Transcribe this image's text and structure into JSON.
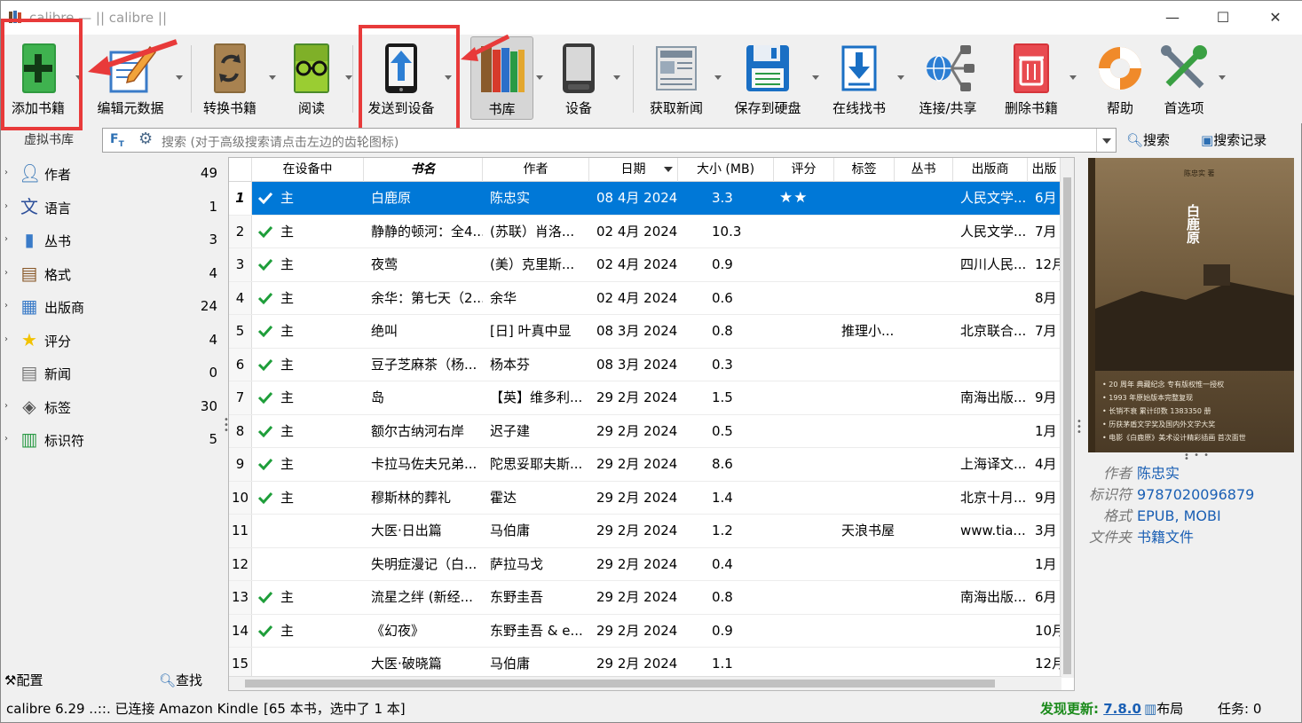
{
  "window": {
    "title": "calibre — || calibre ||",
    "minimize": "—",
    "maximize": "☐",
    "close": "✕"
  },
  "toolbar": {
    "add_books": "添加书籍",
    "edit_metadata": "编辑元数据",
    "convert_books": "转换书籍",
    "view": "阅读",
    "send_to_device": "发送到设备",
    "library": "书库",
    "device": "设备",
    "fetch_news": "获取新闻",
    "save_to_disk": "保存到硬盘",
    "get_books": "在线找书",
    "connect_share": "连接/共享",
    "remove_books": "删除书籍",
    "help": "帮助",
    "preferences": "首选项"
  },
  "search": {
    "virtual_library": "虚拟书库",
    "placeholder": "搜索 (对于高级搜索请点击左边的齿轮图标)",
    "search_button": "搜索",
    "saved_searches_button": "搜索记录"
  },
  "tag_browser": {
    "items": [
      {
        "name": "作者",
        "count": "49",
        "icon": "person-icon",
        "expandable": true
      },
      {
        "name": "语言",
        "count": "1",
        "icon": "language-icon",
        "expandable": true
      },
      {
        "name": "丛书",
        "count": "3",
        "icon": "series-icon",
        "expandable": true
      },
      {
        "name": "格式",
        "count": "4",
        "icon": "format-icon",
        "expandable": true
      },
      {
        "name": "出版商",
        "count": "24",
        "icon": "publisher-icon",
        "expandable": true
      },
      {
        "name": "评分",
        "count": "4",
        "icon": "star-icon",
        "expandable": true
      },
      {
        "name": "新闻",
        "count": "0",
        "icon": "news-icon",
        "expandable": false
      },
      {
        "name": "标签",
        "count": "30",
        "icon": "tag-icon",
        "expandable": true
      },
      {
        "name": "标识符",
        "count": "5",
        "icon": "barcode-icon",
        "expandable": true
      }
    ],
    "configure": "配置",
    "find": "查找"
  },
  "book_list": {
    "columns": [
      "在设备中",
      "书名",
      "作者",
      "日期",
      "大小 (MB)",
      "评分",
      "标签",
      "丛书",
      "出版商",
      "出版"
    ],
    "rows": [
      {
        "n": "1",
        "on_device": "主",
        "checked": true,
        "title": "白鹿原",
        "author": "陈忠实",
        "date": "08 4月 2024",
        "size": "3.3",
        "rating": "★★",
        "tags": "",
        "series": "",
        "publisher": "人民文学...",
        "pub": "6月"
      },
      {
        "n": "2",
        "on_device": "主",
        "checked": true,
        "title": "静静的顿河：全4...",
        "author": "(苏联）肖洛...",
        "date": "02 4月 2024",
        "size": "10.3",
        "rating": "",
        "tags": "",
        "series": "",
        "publisher": "人民文学...",
        "pub": "7月"
      },
      {
        "n": "3",
        "on_device": "主",
        "checked": true,
        "title": "夜莺",
        "author": "(美）克里斯...",
        "date": "02 4月 2024",
        "size": "0.9",
        "rating": "",
        "tags": "",
        "series": "",
        "publisher": "四川人民...",
        "pub": "12月"
      },
      {
        "n": "4",
        "on_device": "主",
        "checked": true,
        "title": "余华：第七天（2...",
        "author": "余华",
        "date": "02 4月 2024",
        "size": "0.6",
        "rating": "",
        "tags": "",
        "series": "",
        "publisher": "",
        "pub": "8月"
      },
      {
        "n": "5",
        "on_device": "主",
        "checked": true,
        "title": "绝叫",
        "author": "[日] 叶真中显",
        "date": "08 3月 2024",
        "size": "0.8",
        "rating": "",
        "tags": "推理小...",
        "series": "",
        "publisher": "北京联合...",
        "pub": "7月"
      },
      {
        "n": "6",
        "on_device": "主",
        "checked": true,
        "title": "豆子芝麻茶（杨...",
        "author": "杨本芬",
        "date": "08 3月 2024",
        "size": "0.3",
        "rating": "",
        "tags": "",
        "series": "",
        "publisher": "",
        "pub": ""
      },
      {
        "n": "7",
        "on_device": "主",
        "checked": true,
        "title": "岛",
        "author": "【英】维多利...",
        "date": "29 2月 2024",
        "size": "1.5",
        "rating": "",
        "tags": "",
        "series": "",
        "publisher": "南海出版...",
        "pub": "9月"
      },
      {
        "n": "8",
        "on_device": "主",
        "checked": true,
        "title": "额尔古纳河右岸",
        "author": "迟子建",
        "date": "29 2月 2024",
        "size": "0.5",
        "rating": "",
        "tags": "",
        "series": "",
        "publisher": "",
        "pub": "1月"
      },
      {
        "n": "9",
        "on_device": "主",
        "checked": true,
        "title": "卡拉马佐夫兄弟...",
        "author": "陀思妥耶夫斯...",
        "date": "29 2月 2024",
        "size": "8.6",
        "rating": "",
        "tags": "",
        "series": "",
        "publisher": "上海译文...",
        "pub": "4月"
      },
      {
        "n": "10",
        "on_device": "主",
        "checked": true,
        "title": "穆斯林的葬礼",
        "author": "霍达",
        "date": "29 2月 2024",
        "size": "1.4",
        "rating": "",
        "tags": "",
        "series": "",
        "publisher": "北京十月...",
        "pub": "9月"
      },
      {
        "n": "11",
        "on_device": "",
        "checked": false,
        "title": "大医·日出篇",
        "author": "马伯庸",
        "date": "29 2月 2024",
        "size": "1.2",
        "rating": "",
        "tags": "天浪书屋",
        "series": "",
        "publisher": "www.tia...",
        "pub": "3月"
      },
      {
        "n": "12",
        "on_device": "",
        "checked": false,
        "title": "失明症漫记（白...",
        "author": "萨拉马戈",
        "date": "29 2月 2024",
        "size": "0.4",
        "rating": "",
        "tags": "",
        "series": "",
        "publisher": "",
        "pub": "1月"
      },
      {
        "n": "13",
        "on_device": "主",
        "checked": true,
        "title": "流星之绊 (新经...",
        "author": "东野圭吾",
        "date": "29 2月 2024",
        "size": "0.8",
        "rating": "",
        "tags": "",
        "series": "",
        "publisher": "南海出版...",
        "pub": "6月"
      },
      {
        "n": "14",
        "on_device": "主",
        "checked": true,
        "title": "《幻夜》",
        "author": "东野圭吾 & e...",
        "date": "29 2月 2024",
        "size": "0.9",
        "rating": "",
        "tags": "",
        "series": "",
        "publisher": "",
        "pub": "10月"
      },
      {
        "n": "15",
        "on_device": "",
        "checked": false,
        "title": "大医·破晓篇",
        "author": "马伯庸",
        "date": "29 2月 2024",
        "size": "1.1",
        "rating": "",
        "tags": "",
        "series": "",
        "publisher": "",
        "pub": "12月"
      }
    ]
  },
  "cover": {
    "author_small": "陈忠实 著",
    "title_vertical": "白鹿原",
    "lines": [
      "• 20 周年 典藏纪念 专有版权惟一授权",
      "• 1993 年原始版本完整复现",
      "• 长销不衰 累计印数 1383350 册",
      "• 历获茅盾文学奖及国内外文学大奖",
      "• 电影《白鹿原》美术设计精彩插画 首次面世"
    ]
  },
  "details": {
    "author_label": "作者",
    "author_value": "陈忠实",
    "ids_label": "标识符",
    "ids_value": "9787020096879",
    "formats_label": "格式",
    "formats_value": "EPUB, MOBI",
    "path_label": "文件夹",
    "path_value": "书籍文件"
  },
  "status": {
    "left": "calibre 6.29 ..::. 已连接 Amazon Kindle",
    "count": "[65 本书，选中了 1 本]",
    "update_prefix": "发现更新:",
    "update_version": "7.8.0",
    "layout": "布局",
    "jobs": "任务:  0"
  },
  "colors": {
    "accent": "#0078d7",
    "annotation_red": "#e83a3a",
    "check_green": "#1e9e3a",
    "link_blue": "#1a5fb4"
  }
}
